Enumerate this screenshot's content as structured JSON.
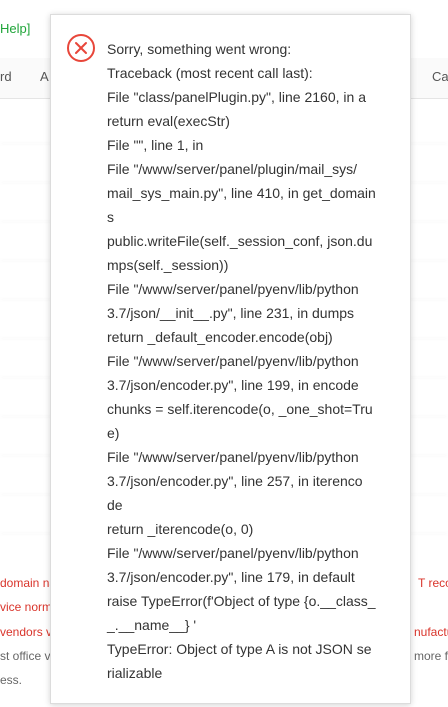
{
  "background": {
    "help_text": "Help]",
    "tabs": [
      "rd",
      "A",
      "Ca"
    ],
    "truncated_lines": [
      "domain na",
      "T recor",
      "vice norm",
      "vendors v",
      "nufactu",
      "st office v",
      "more f",
      "ess."
    ]
  },
  "dialog": {
    "icon": "error-x-icon",
    "lines": [
      "Sorry, something went wrong:",
      "Traceback (most recent call last):",
      "File \"class/panelPlugin.py\", line 2160, in a",
      "return eval(execStr)",
      "File \"\", line 1, in",
      "File \"/www/server/panel/plugin/mail_sys/",
      "mail_sys_main.py\", line 410, in get_domain",
      "s",
      "public.writeFile(self._session_conf, json.du",
      "mps(self._session))",
      "File \"/www/server/panel/pyenv/lib/python",
      "3.7/json/__init__.py\", line 231, in dumps",
      "return _default_encoder.encode(obj)",
      "File \"/www/server/panel/pyenv/lib/python",
      "3.7/json/encoder.py\", line 199, in encode",
      "chunks = self.iterencode(o, _one_shot=Tru",
      "e)",
      "File \"/www/server/panel/pyenv/lib/python",
      "3.7/json/encoder.py\", line 257, in iterenco",
      "de",
      "return _iterencode(o, 0)",
      "File \"/www/server/panel/pyenv/lib/python",
      "3.7/json/encoder.py\", line 179, in default",
      "raise TypeError(f'Object of type {o.__class_",
      "_.__name__} '",
      "TypeError: Object of type A is not JSON se",
      "rializable"
    ]
  },
  "colors": {
    "error_red": "#e8463a",
    "link_green": "#20a53a",
    "text": "#333333"
  }
}
